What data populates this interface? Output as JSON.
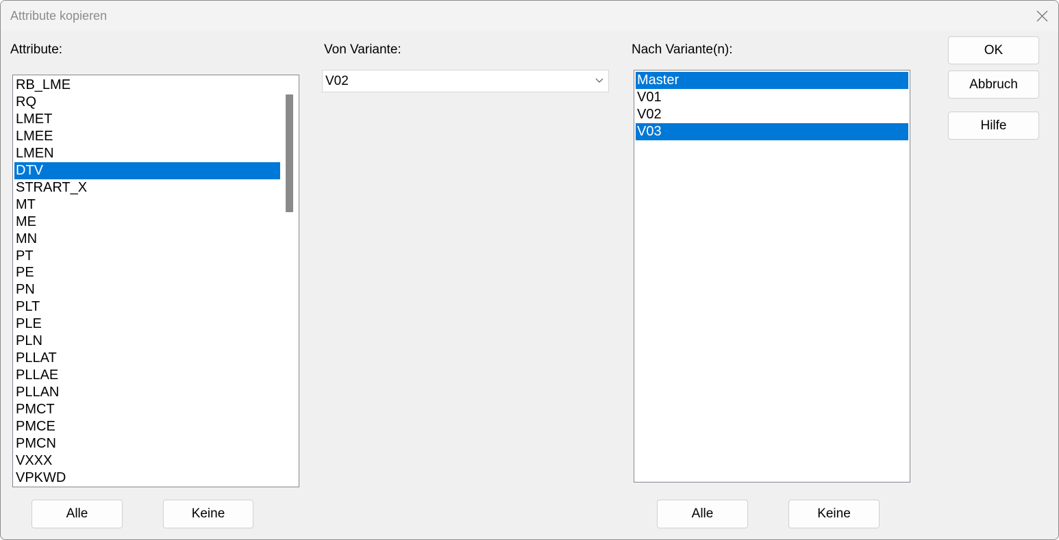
{
  "window": {
    "title": "Attribute kopieren"
  },
  "attributes": {
    "label": "Attribute:",
    "items": [
      {
        "label": "RB_LME",
        "selected": false
      },
      {
        "label": "RQ",
        "selected": false
      },
      {
        "label": "LMET",
        "selected": false
      },
      {
        "label": "LMEE",
        "selected": false
      },
      {
        "label": "LMEN",
        "selected": false
      },
      {
        "label": "DTV",
        "selected": true
      },
      {
        "label": "STRART_X",
        "selected": false
      },
      {
        "label": "MT",
        "selected": false
      },
      {
        "label": "ME",
        "selected": false
      },
      {
        "label": "MN",
        "selected": false
      },
      {
        "label": "PT",
        "selected": false
      },
      {
        "label": "PE",
        "selected": false
      },
      {
        "label": "PN",
        "selected": false
      },
      {
        "label": "PLT",
        "selected": false
      },
      {
        "label": "PLE",
        "selected": false
      },
      {
        "label": "PLN",
        "selected": false
      },
      {
        "label": "PLLAT",
        "selected": false
      },
      {
        "label": "PLLAE",
        "selected": false
      },
      {
        "label": "PLLAN",
        "selected": false
      },
      {
        "label": "PMCT",
        "selected": false
      },
      {
        "label": "PMCE",
        "selected": false
      },
      {
        "label": "PMCN",
        "selected": false
      },
      {
        "label": "VXXX",
        "selected": false
      },
      {
        "label": "VPKWD",
        "selected": false
      }
    ],
    "all_button": "Alle",
    "none_button": "Keine"
  },
  "source_variant": {
    "label": "Von Variante:",
    "value": "V02"
  },
  "target_variants": {
    "label": "Nach Variante(n):",
    "items": [
      {
        "label": "Master",
        "selected": true
      },
      {
        "label": "V01",
        "selected": false
      },
      {
        "label": "V02",
        "selected": false
      },
      {
        "label": "V03",
        "selected": true
      }
    ],
    "all_button": "Alle",
    "none_button": "Keine"
  },
  "actions": {
    "ok": "OK",
    "cancel": "Abbruch",
    "help": "Hilfe"
  },
  "colors": {
    "selection": "#0078d7",
    "dialog_background": "#f0f0f0"
  }
}
